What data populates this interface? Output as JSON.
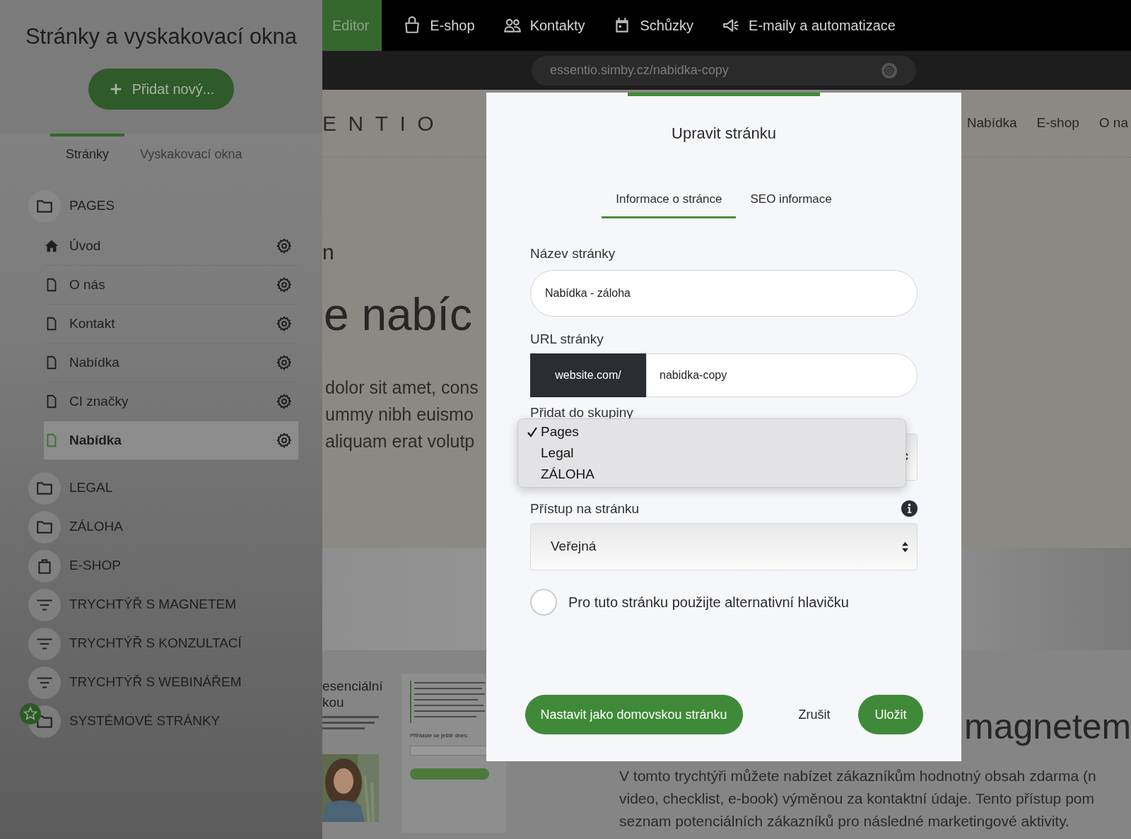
{
  "top_nav": {
    "items": [
      {
        "label": "Editor",
        "selected": true
      },
      {
        "label": "E-shop",
        "selected": false
      },
      {
        "label": "Kontakty",
        "selected": false
      },
      {
        "label": "Schůzky",
        "selected": false
      },
      {
        "label": "E-maily a automatizace",
        "selected": false
      }
    ]
  },
  "url_bar": {
    "value": "essentio.simby.cz/nabidka-copy"
  },
  "sidebar": {
    "title": "Stránky a vyskakovací okna",
    "add_button": "Přidat nový...",
    "tabs": [
      {
        "label": "Stránky",
        "selected": true
      },
      {
        "label": "Vyskakovací okna",
        "selected": false
      }
    ],
    "tree": [
      {
        "label": "PAGES",
        "kind": "folder",
        "selected": false,
        "children": [
          {
            "label": "Úvod",
            "kind": "home",
            "selected": false
          },
          {
            "label": "O nás",
            "kind": "page",
            "selected": false
          },
          {
            "label": "Kontakt",
            "kind": "page",
            "selected": false
          },
          {
            "label": "Nabídka",
            "kind": "page",
            "selected": false
          },
          {
            "label": "CI značky",
            "kind": "page",
            "selected": false
          },
          {
            "label": "Nabídka",
            "kind": "page",
            "selected": true
          }
        ]
      },
      {
        "label": "LEGAL",
        "kind": "folder",
        "selected": false
      },
      {
        "label": "ZÁLOHA",
        "kind": "folder",
        "selected": false
      },
      {
        "label": "E-SHOP",
        "kind": "shop",
        "selected": false
      },
      {
        "label": "TRYCHTÝŘ S MAGNETEM",
        "kind": "funnel",
        "selected": false
      },
      {
        "label": "TRYCHTÝŘ S KONZULTACÍ",
        "kind": "funnel",
        "selected": false
      },
      {
        "label": "TRYCHTÝŘ S WEBINÁŘEM",
        "kind": "funnel",
        "selected": false
      },
      {
        "label": "SYSTÉMOVÉ STRÁNKY",
        "kind": "system",
        "selected": false
      }
    ]
  },
  "preview": {
    "logo": "ENTIO",
    "nav": [
      "Nabídka",
      "E-shop",
      "O na"
    ],
    "fragment": "n",
    "headline": "e nabíc",
    "lines": [
      "dolor sit amet, cons",
      "ummy nibh euismo",
      "aliquam erat volutp"
    ],
    "card_heading": [
      "esenciální",
      "kou"
    ],
    "signup": "Přihlaste se ještě dnes:",
    "section_heading": "magnetem",
    "section_lines": [
      "V tomto trychtýři můžete nabízet zákazníkům hodnotný obsah zdarma (n",
      "video, checklist, e-book) výměnou za kontaktní údaje. Tento přístup pom",
      "seznam potenciálních zákazníků pro následné marketingové aktivity."
    ]
  },
  "modal": {
    "title": "Upravit stránku",
    "tabs": [
      {
        "label": "Informace o stránce",
        "selected": true
      },
      {
        "label": "SEO informace",
        "selected": false
      }
    ],
    "name_label": "Název stránky",
    "name_value": "Nabídka - záloha",
    "url_label": "URL stránky",
    "url_prefix": "website.com/",
    "url_value": "nabidka-copy",
    "group_label": "Přidat do skupiny",
    "group_options": [
      {
        "label": "Pages",
        "selected": true
      },
      {
        "label": "Legal",
        "selected": false
      },
      {
        "label": "ZÁLOHA",
        "selected": false
      }
    ],
    "access_label": "Přístup na stránku",
    "access_value": "Veřejná",
    "alt_header": {
      "label": "Pro tuto stránku použijte alternativní hlavičku",
      "checked": false
    },
    "buttons": {
      "home": "Nastavit jako domovskou stránku",
      "cancel": "Zrušit",
      "save": "Uložit"
    }
  }
}
